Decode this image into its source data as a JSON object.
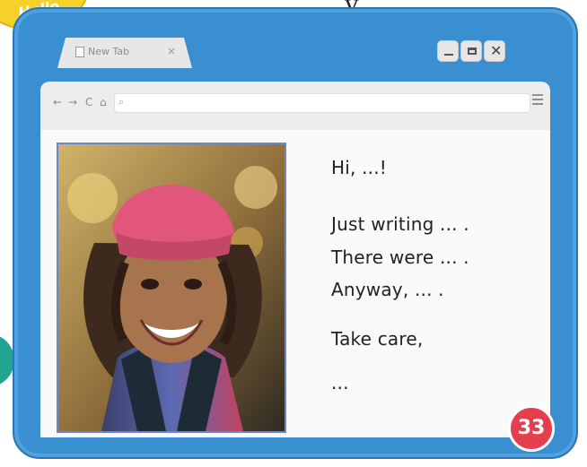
{
  "header": {
    "sticker_label": "Hello",
    "top_glyph": "y"
  },
  "browser": {
    "tab": {
      "title": "New Tab",
      "close_label": "×",
      "icon": "page-icon"
    },
    "window_controls": {
      "minimize_icon": "minimize-icon",
      "maximize_icon": "maximize-icon",
      "close_label": "✕"
    },
    "toolbar": {
      "back_label": "←",
      "forward_label": "→",
      "reload_label": "C",
      "home_label": "⌂",
      "search_label": "⌕",
      "address_value": "",
      "menu_icon": "menu-icon"
    }
  },
  "message": {
    "greeting": "Hi, ...!",
    "line1": "Just writing ... .",
    "line2": "There were ... .",
    "line3": "Anyway, ... .",
    "closing": "Take care,",
    "signature": "..."
  },
  "footer": {
    "page_number": "33"
  },
  "colors": {
    "window_blue": "#3a8fd0",
    "browser_gray": "#ededed",
    "badge_red": "#e43f4e",
    "sticker_yellow": "#f6d12a",
    "teal_accent": "#21a58e"
  }
}
